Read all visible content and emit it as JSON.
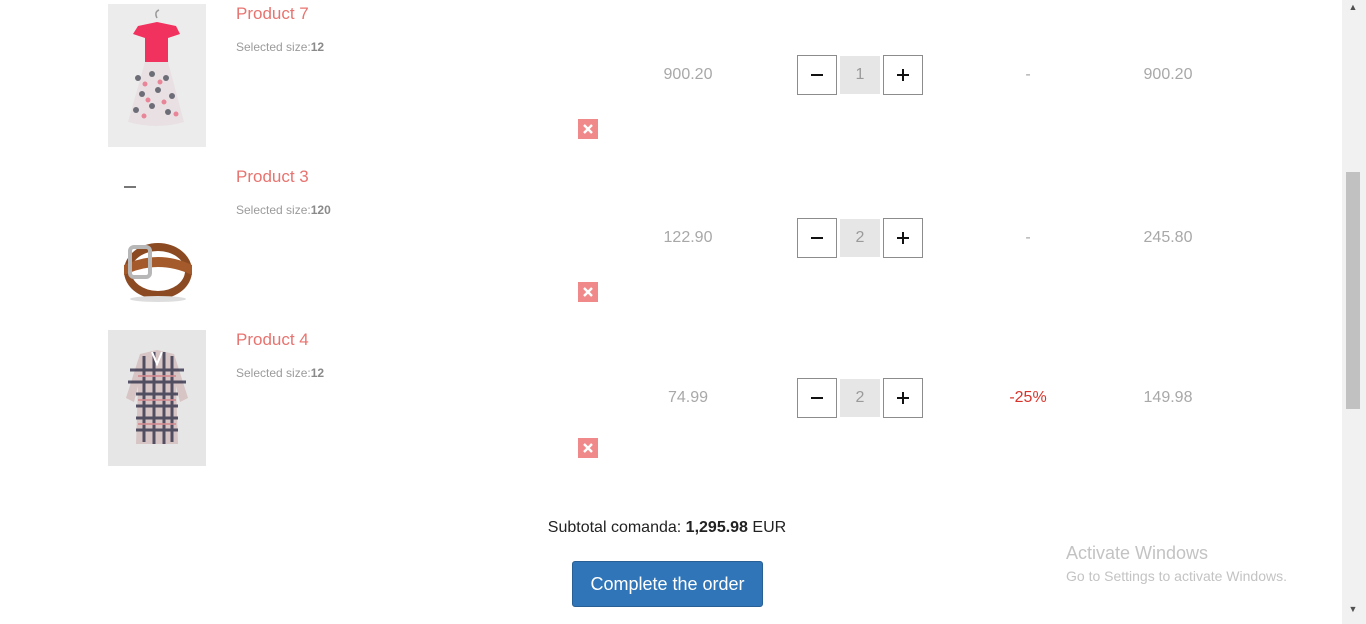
{
  "cart": {
    "size_label": "Selected size:",
    "items": [
      {
        "name": "Product 7",
        "size": "12",
        "price": "900.20",
        "quantity": "1",
        "discount": "-",
        "total": "900.20"
      },
      {
        "name": "Product 3",
        "size": "120",
        "price": "122.90",
        "quantity": "2",
        "discount": "-",
        "total": "245.80"
      },
      {
        "name": "Product 4",
        "size": "12",
        "price": "74.99",
        "quantity": "2",
        "discount": "-25%",
        "total": "149.98"
      }
    ],
    "subtotal_label": "Subtotal comanda:",
    "subtotal_value": "1,295.98",
    "currency": "EUR",
    "complete_button": "Complete the order"
  },
  "watermark": {
    "title": "Activate Windows",
    "subtitle": "Go to Settings to activate Windows."
  },
  "icons": {
    "remove": "close-icon",
    "decrease": "minus-icon",
    "increase": "plus-icon"
  },
  "colors": {
    "product_name": "#e8736f",
    "remove_button": "#f08a8a",
    "discount_red": "#d9342b",
    "order_button": "#2f75b8"
  }
}
